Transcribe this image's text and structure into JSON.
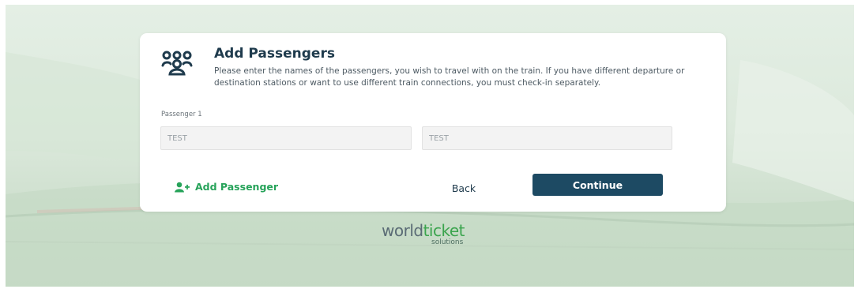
{
  "card": {
    "icon": "people-group-icon",
    "title": "Add Passengers",
    "description": "Please enter the names of the passengers, you wish to travel with on the train. If you have different departure or destination stations or want to use different train connections, you must check-in separately."
  },
  "passenger": {
    "label": "Passenger 1",
    "first_name_value": "TEST",
    "last_name_value": "TEST"
  },
  "actions": {
    "add_passenger_icon": "user-plus-icon",
    "add_passenger_label": "Add Passenger",
    "back_label": "Back",
    "continue_label": "Continue"
  },
  "logo": {
    "world": "world",
    "ticket": "ticket",
    "sub": "solutions"
  },
  "colors": {
    "accent_green": "#27a35a",
    "primary_button": "#1d4a63",
    "title_text": "#1f3b4d"
  }
}
